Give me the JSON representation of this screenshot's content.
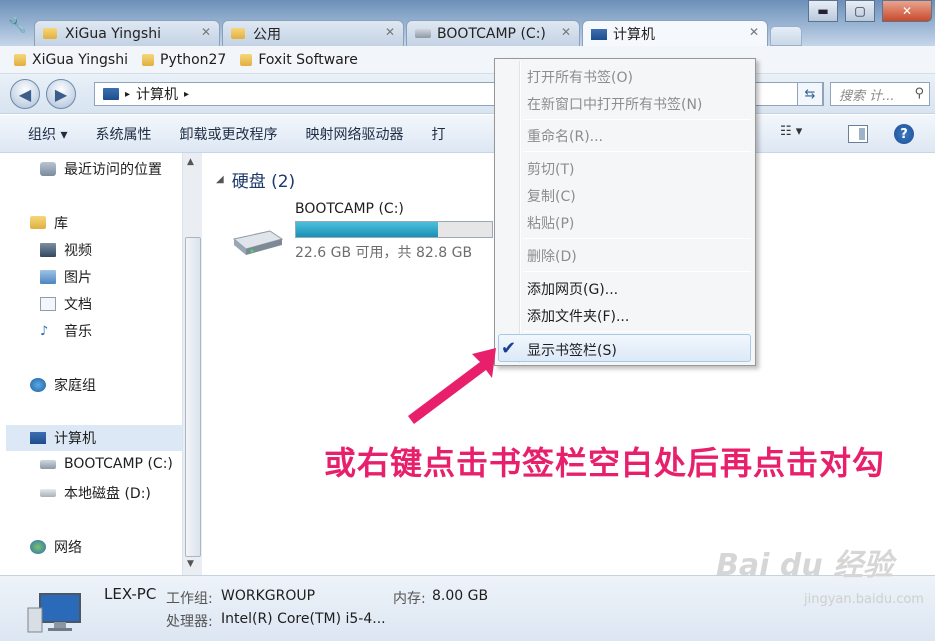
{
  "tabs": [
    {
      "label": "XiGua Yingshi",
      "icon": "folder-icon"
    },
    {
      "label": "公用",
      "icon": "folder-icon"
    },
    {
      "label": "BOOTCAMP (C:)",
      "icon": "drive-icon"
    },
    {
      "label": "计算机",
      "icon": "computer-icon",
      "active": true
    }
  ],
  "window_buttons": {
    "minimize": "▬",
    "maximize": "▢",
    "close": "✕"
  },
  "bookmarks": [
    "XiGua Yingshi",
    "Python27",
    "Foxit Software"
  ],
  "address": {
    "path": "计算机",
    "separator_after": "▸",
    "search_placeholder": "搜索 计..."
  },
  "toolbar": {
    "items": [
      "组织 ▾",
      "系统属性",
      "卸载或更改程序",
      "映射网络驱动器",
      "打"
    ],
    "view_label": "☷ ▾",
    "help_label": "?"
  },
  "navpane": {
    "recent": "最近访问的位置",
    "library": "库",
    "videos": "视频",
    "pictures": "图片",
    "documents": "文档",
    "music": "音乐",
    "homegroup": "家庭组",
    "computer": "计算机",
    "drive_c": "BOOTCAMP (C:)",
    "drive_d": "本地磁盘 (D:)",
    "network": "网络"
  },
  "main": {
    "group_header": "硬盘 (2)",
    "drive": {
      "name": "BOOTCAMP (C:)",
      "free_text": "22.6 GB 可用，共 82.8 GB",
      "used_fraction": 0.727
    }
  },
  "context_menu": {
    "open_all": "打开所有书签(O)",
    "open_all_new_window": "在新窗口中打开所有书签(N)",
    "rename": "重命名(R)...",
    "cut": "剪切(T)",
    "copy": "复制(C)",
    "paste": "粘贴(P)",
    "delete": "删除(D)",
    "add_page": "添加网页(G)...",
    "add_folder": "添加文件夹(F)...",
    "show_bookmarks_bar": "显示书签栏(S)",
    "check_mark": "✔"
  },
  "details": {
    "pc_name": "LEX-PC",
    "workgroup_label": "工作组:",
    "workgroup": "WORKGROUP",
    "memory_label": "内存:",
    "memory": "8.00 GB",
    "processor_label": "处理器:",
    "processor": "Intel(R) Core(TM) i5-4..."
  },
  "annotation": "或右键点击书签栏空白处后再点击对勾",
  "watermark": {
    "main": "Bai du 经验",
    "sub": "jingyan.baidu.com"
  },
  "colors": {
    "annotation": "#e8206c",
    "arrow": "#e8206c",
    "drive_fill": "#1b8fb4",
    "check": "#1c3f92"
  }
}
